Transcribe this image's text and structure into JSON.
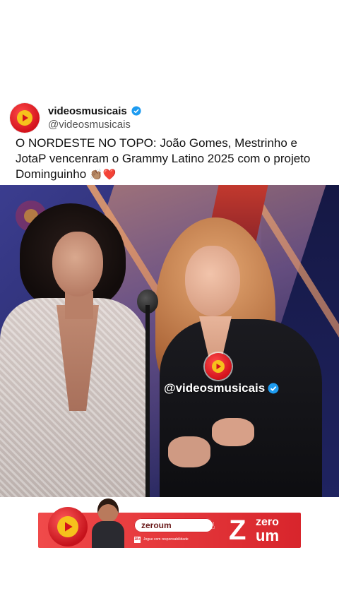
{
  "post": {
    "display_name": "videosmusicais",
    "handle": "@videosmusicais",
    "verified_icon": "verified-badge-icon",
    "caption": "O NORDESTE NO TOPO: João Gomes, Mestrinho e JotaP vencenram o Grammy Latino 2025 com o projeto Dominguinho",
    "caption_emojis": "👏🏽❤️"
  },
  "media": {
    "overlay_handle": "@videosmusicais",
    "overlay_icon": "play-logo-icon"
  },
  "ad": {
    "search_text": "zeroum",
    "brand_small": "zero",
    "brand_big": "um",
    "brand_letter": "Z",
    "age": "18+",
    "disclaimer": "Jogue com responsabilidade",
    "accent_color": "#d8252c"
  },
  "colors": {
    "avatar_red": "#d3121b",
    "play_yellow": "#f6c21c",
    "verified_blue": "#1d9bf0"
  }
}
